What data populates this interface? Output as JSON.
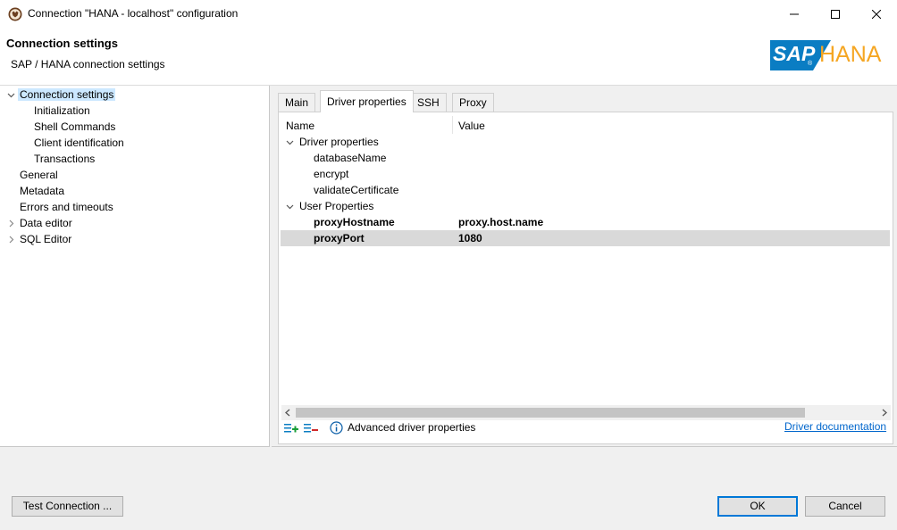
{
  "window": {
    "title": "Connection \"HANA - localhost\" configuration",
    "controls": [
      "minimize-icon",
      "maximize-icon",
      "close-icon"
    ]
  },
  "header": {
    "title": "Connection settings",
    "subtitle": "SAP / HANA connection settings",
    "logo_sap": "SAP",
    "logo_hana": "HANA",
    "logo_mark": "®"
  },
  "tree": {
    "items": [
      {
        "label": "Connection settings",
        "expanded": true,
        "selected": true
      },
      {
        "label": "Initialization"
      },
      {
        "label": "Shell Commands"
      },
      {
        "label": "Client identification"
      },
      {
        "label": "Transactions"
      },
      {
        "label": "General"
      },
      {
        "label": "Metadata"
      },
      {
        "label": "Errors and timeouts"
      },
      {
        "label": "Data editor",
        "expanded": false
      },
      {
        "label": "SQL Editor",
        "expanded": false
      }
    ]
  },
  "tabs": [
    "Main",
    "Driver properties",
    "SSH",
    "Proxy"
  ],
  "active_tab": "Driver properties",
  "props": {
    "columns": [
      "Name",
      "Value"
    ],
    "groups": [
      {
        "label": "Driver properties",
        "rows": [
          {
            "name": "databaseName",
            "value": ""
          },
          {
            "name": "encrypt",
            "value": ""
          },
          {
            "name": "validateCertificate",
            "value": ""
          }
        ]
      },
      {
        "label": "User Properties",
        "rows": [
          {
            "name": "proxyHostname",
            "value": "proxy.host.name"
          },
          {
            "name": "proxyPort",
            "value": "1080"
          }
        ]
      }
    ]
  },
  "toolbar": {
    "advanced_label": "Advanced driver properties",
    "doc_link": "Driver documentation"
  },
  "footer": {
    "test_connection": "Test Connection ...",
    "ok": "OK",
    "cancel": "Cancel"
  },
  "colors": {
    "selection": "#cce8ff",
    "highlight_row": "#d9d9d9",
    "sap_blue": "#0a7dc3",
    "hana_orange": "#f5a623",
    "link": "#0066cc",
    "add_green": "#1a9e3a",
    "remove_red": "#d02b2b"
  }
}
